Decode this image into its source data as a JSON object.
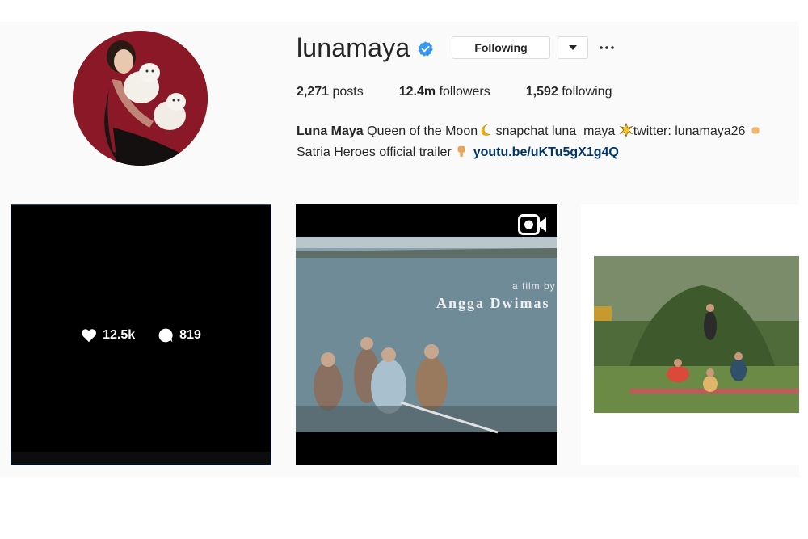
{
  "profile": {
    "username": "lunamaya",
    "verified": true,
    "following_label": "Following",
    "stats": {
      "posts_count": "2,271",
      "posts_label": "posts",
      "followers_count": "12.4m",
      "followers_label": "followers",
      "following_count": "1,592",
      "following_label": "following"
    },
    "bio": {
      "full_name": "Luna Maya",
      "line1_text": "Queen of the Moon",
      "line1_snap": "snapchat luna_maya",
      "line1_twitter": "twitter: lunamaya26",
      "line2_text": "Satria Heroes official trailer",
      "link": "youtu.be/uKTu5gX1g4Q"
    }
  },
  "posts": [
    {
      "likes": "12.5k",
      "comments": "819",
      "type": "photo-hover"
    },
    {
      "type": "video",
      "caption_small": "a film by",
      "caption_large": "Angga Dwimas"
    },
    {
      "type": "photo"
    }
  ],
  "colors": {
    "verified": "#3897f0",
    "link": "#003569",
    "panel_bg": "#fafafa",
    "avatar_bg": "#7a1420"
  },
  "icons": [
    "verified-badge-icon",
    "caret-down-icon",
    "more-options-icon",
    "heart-icon",
    "comment-icon",
    "video-camera-icon",
    "moon-emoji",
    "sparkle-emoji",
    "hand-pointing-emoji"
  ]
}
